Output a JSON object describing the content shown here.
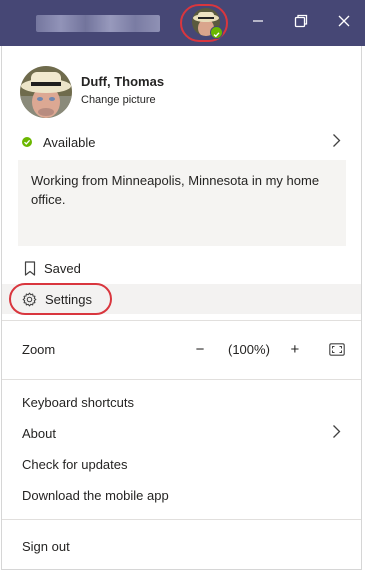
{
  "profile": {
    "name": "Duff, Thomas",
    "change_picture": "Change picture"
  },
  "status": {
    "label": "Available",
    "color": "#6bb700",
    "message": "Working from Minneapolis, Minnesota in my home office."
  },
  "menu": {
    "saved": "Saved",
    "settings": "Settings",
    "zoom_label": "Zoom",
    "zoom_minus": "−",
    "zoom_value": "(100%)",
    "zoom_plus": "+",
    "keyboard_shortcuts": "Keyboard shortcuts",
    "about": "About",
    "check_updates": "Check for updates",
    "download_mobile": "Download the mobile app",
    "sign_out": "Sign out"
  },
  "theme": {
    "titlebar": "#464775",
    "highlight_ring": "#d9363e",
    "hover_background": "#f3f2f1"
  },
  "icons": [
    "minimize-icon",
    "restore-icon",
    "close-icon",
    "check-icon",
    "chevron-right-icon",
    "bookmark-icon",
    "gear-icon",
    "fullscreen-icon"
  ]
}
